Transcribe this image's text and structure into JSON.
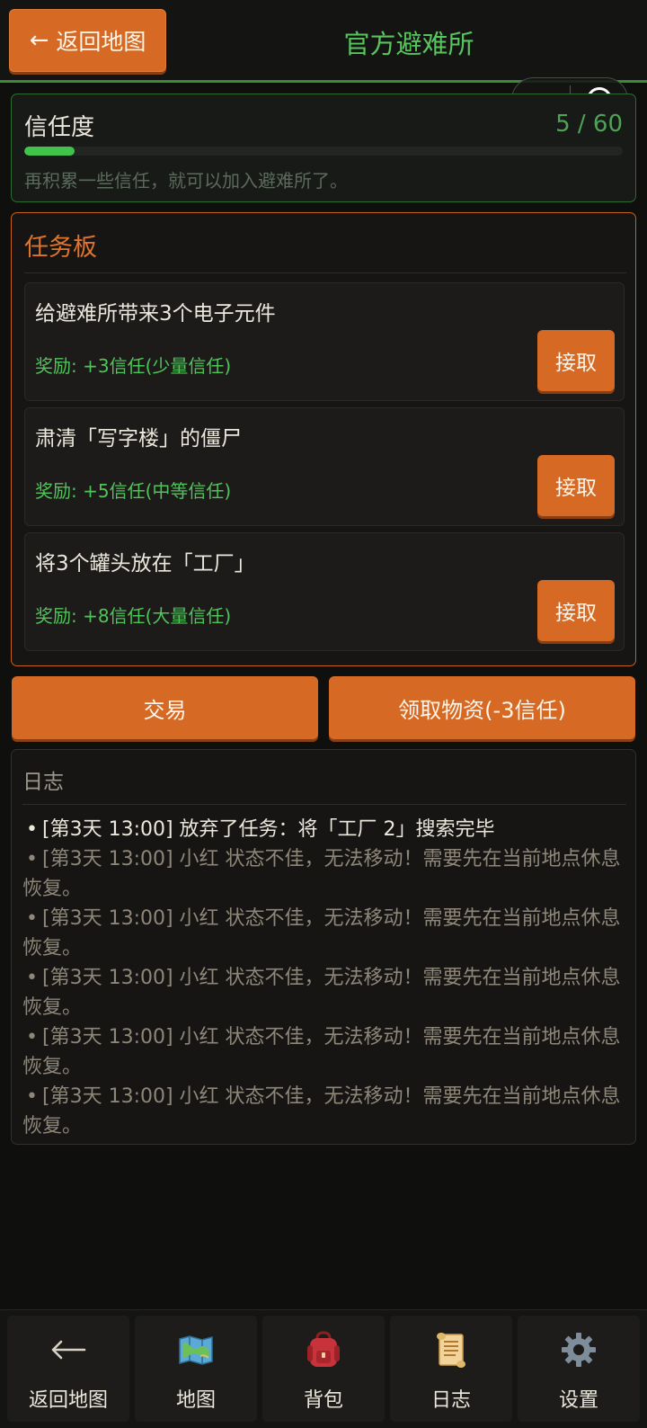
{
  "header": {
    "back_arrow": "←",
    "back_label": "返回地图",
    "title": "官方避难所"
  },
  "trust": {
    "label": "信任度",
    "count_text": "5 / 60",
    "value": 5,
    "max": 60,
    "hint": "再积累一些信任，就可以加入避难所了。"
  },
  "task_board": {
    "title": "任务板",
    "tasks": [
      {
        "name": "给避难所带来3个电子元件",
        "reward": "奖励: +3信任(少量信任)",
        "button": "接取"
      },
      {
        "name": "肃清「写字楼」的僵尸",
        "reward": "奖励: +5信任(中等信任)",
        "button": "接取"
      },
      {
        "name": "将3个罐头放在「工厂」",
        "reward": "奖励: +8信任(大量信任)",
        "button": "接取"
      }
    ]
  },
  "actions": {
    "trade": "交易",
    "collect": "领取物资(-3信任)"
  },
  "log": {
    "title": "日志",
    "bullet": "•",
    "entries": [
      "[第3天 13:00] 放弃了任务：将「工厂 2」搜索完毕",
      "[第3天 13:00] 小红 状态不佳，无法移动！需要先在当前地点休息恢复。",
      "[第3天 13:00] 小红 状态不佳，无法移动！需要先在当前地点休息恢复。",
      "[第3天 13:00] 小红 状态不佳，无法移动！需要先在当前地点休息恢复。",
      "[第3天 13:00] 小红 状态不佳，无法移动！需要先在当前地点休息恢复。",
      "[第3天 13:00] 小红 状态不佳，无法移动！需要先在当前地点休息恢复。"
    ]
  },
  "bottom_nav": [
    {
      "label": "返回地图",
      "icon": "back-arrow-icon"
    },
    {
      "label": "地图",
      "icon": "map-icon"
    },
    {
      "label": "背包",
      "icon": "backpack-icon"
    },
    {
      "label": "日志",
      "icon": "scroll-icon"
    },
    {
      "label": "设置",
      "icon": "gear-icon"
    }
  ],
  "colors": {
    "accent_orange": "#d66a24",
    "accent_green": "#4fc45a",
    "background": "#0f0f0e"
  }
}
